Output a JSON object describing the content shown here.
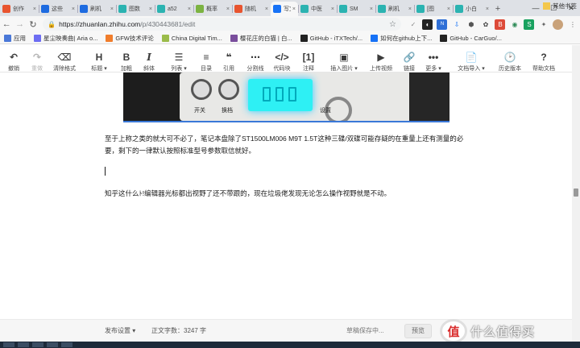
{
  "browser": {
    "tabs": [
      {
        "label": "创作",
        "color": "#e8542f"
      },
      {
        "label": "这些",
        "color": "#1e6be0"
      },
      {
        "label": "刷机",
        "color": "#1e6be0"
      },
      {
        "label": "图数",
        "color": "#2bb3b1"
      },
      {
        "label": "a52",
        "color": "#2bb3b1"
      },
      {
        "label": "概率",
        "color": "#7cb342"
      },
      {
        "label": "随机",
        "color": "#e8542f"
      },
      {
        "label": "写文",
        "color": "#1772f6",
        "active": true
      },
      {
        "label": "中医",
        "color": "#2bb3b1"
      },
      {
        "label": "SM",
        "color": "#2bb3b1"
      },
      {
        "label": "刷机",
        "color": "#2bb3b1"
      },
      {
        "label": "[图",
        "color": "#2bb3b1"
      },
      {
        "label": "小白",
        "color": "#2bb3b1"
      }
    ],
    "tab_close": "×",
    "new_tab": "+",
    "window_controls": {
      "minimize": "—",
      "maximize": "☐",
      "close": "✕"
    },
    "url_host": "https://zhuanlan.zhihu.com",
    "url_path": "/p/430443681/edit",
    "bookmarks": [
      {
        "label": "应用",
        "color": "#4a78d8"
      },
      {
        "label": "星尘映奏曲| Aria o...",
        "color": "#6d6df2"
      },
      {
        "label": "GFW技术评论",
        "color": "#f07d2c"
      },
      {
        "label": "China Digital Tim...",
        "color": "#9bbc4a"
      },
      {
        "label": "樱花庄的白猫 | 白...",
        "color": "#7a4e9c"
      },
      {
        "label": "GitHub - iTXTech/...",
        "color": "#222222"
      },
      {
        "label": "如何在github上下...",
        "color": "#1772f6"
      },
      {
        "label": "GitHub - CarGuo/...",
        "color": "#222222"
      }
    ],
    "bookmarks_other": "其他书签"
  },
  "toolbar": {
    "items": [
      {
        "name": "undo-button",
        "icon": "↶",
        "label": "撤销",
        "disabled": false
      },
      {
        "name": "redo-button",
        "icon": "↷",
        "label": "重做",
        "disabled": true
      },
      {
        "name": "clear-format-button",
        "icon": "⌫",
        "label": "清除格式",
        "disabled": false
      },
      {
        "name": "heading-button",
        "icon": "H",
        "label": "标题 ▾",
        "disabled": false
      },
      {
        "name": "bold-button",
        "icon": "B",
        "label": "加粗",
        "disabled": false
      },
      {
        "name": "italic-button",
        "icon": "I",
        "label": "斜体",
        "disabled": false
      },
      {
        "name": "list-button",
        "icon": "☰",
        "label": "列表 ▾",
        "disabled": false
      },
      {
        "name": "toc-button",
        "icon": "≡",
        "label": "目录",
        "disabled": false
      },
      {
        "name": "quote-button",
        "icon": "❝",
        "label": "引用",
        "disabled": false
      },
      {
        "name": "divider-button",
        "icon": "⋯",
        "label": "分割线",
        "disabled": false
      },
      {
        "name": "code-block-button",
        "icon": "</>",
        "label": "代码块",
        "disabled": false
      },
      {
        "name": "footnote-button",
        "icon": "[1]",
        "label": "注释",
        "disabled": false
      },
      {
        "name": "insert-image-button",
        "icon": "▣",
        "label": "插入图片 ▾",
        "disabled": false
      },
      {
        "name": "upload-video-button",
        "icon": "▶",
        "label": "上传视频",
        "disabled": false
      },
      {
        "name": "link-button",
        "icon": "🔗",
        "label": "链接",
        "disabled": false
      },
      {
        "name": "more-button",
        "icon": "•••",
        "label": "更多 ▾",
        "disabled": false
      },
      {
        "name": "import-doc-button",
        "icon": "📄",
        "label": "文档导入 ▾",
        "disabled": false
      },
      {
        "name": "history-button",
        "icon": "🕑",
        "label": "历史版本",
        "disabled": false
      },
      {
        "name": "help-doc-button",
        "icon": "?",
        "label": "帮助文档",
        "disabled": false
      }
    ]
  },
  "document": {
    "image_labels": {
      "left": "开关",
      "mid": "换档",
      "right": "设置"
    },
    "paragraph1": "至于上称之类的就大可不必了，笔记本盘除了ST1500LM006 M9T 1.5T这种三碟/双碟可能存疑的在重量上还有测量的必要，剩下的一律默认按照标准型号参数取信就好。",
    "paragraph2": "知乎这什么ﾄ!编辑器光标都出视野了还不带跟的，现在垃圾佬发现无论怎么操作视野就是不动。"
  },
  "footer": {
    "publish_settings": "发布设置 ▾",
    "word_count": "正文字数：3247 字",
    "draft_status": "草稿保存中...",
    "preview": "预览"
  },
  "watermark": {
    "badge": "值",
    "text": "什么值得买"
  }
}
